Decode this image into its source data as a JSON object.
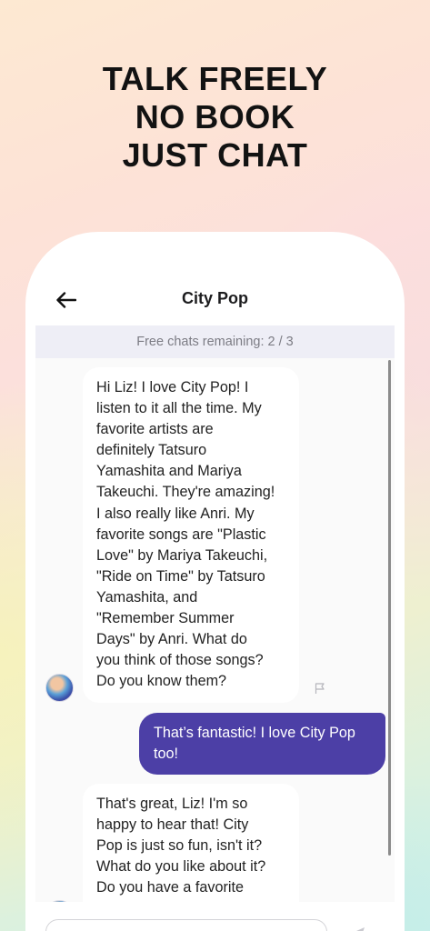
{
  "headline": {
    "line1": "TALK FREELY",
    "line2": "NO BOOK",
    "line3": "JUST CHAT"
  },
  "chat": {
    "title": "City Pop",
    "free_chats_text": "Free chats remaining: 2 / 3",
    "messages": [
      {
        "role": "bot",
        "text": "Hi Liz! I love City Pop! I\nlisten to it all the time.  My\nfavorite artists are\ndefinitely Tatsuro\nYamashita and Mariya\nTakeuchi. They're amazing!\nI also really like Anri.  My\nfavorite songs are \"Plastic\nLove\" by Mariya Takeuchi,\n\"Ride on Time\" by Tatsuro\nYamashita, and\n\"Remember Summer\nDays\" by Anri. What do\nyou think of those songs?\nDo you know them?"
      },
      {
        "role": "user",
        "text": "That’s fantastic! I love City Pop too!"
      },
      {
        "role": "bot",
        "text": "That's great, Liz! I'm so\nhappy to hear that! City\nPop is just so fun, isn't it?\nWhat do you like about it?\nDo you have a favorite"
      }
    ]
  },
  "icons": {
    "back": "arrow-left-icon",
    "flag": "flag-icon",
    "send": "send-icon",
    "avatar": "avatar"
  },
  "colors": {
    "user_bubble": "#4c3fa6",
    "banner_bg": "#eeeef6"
  }
}
